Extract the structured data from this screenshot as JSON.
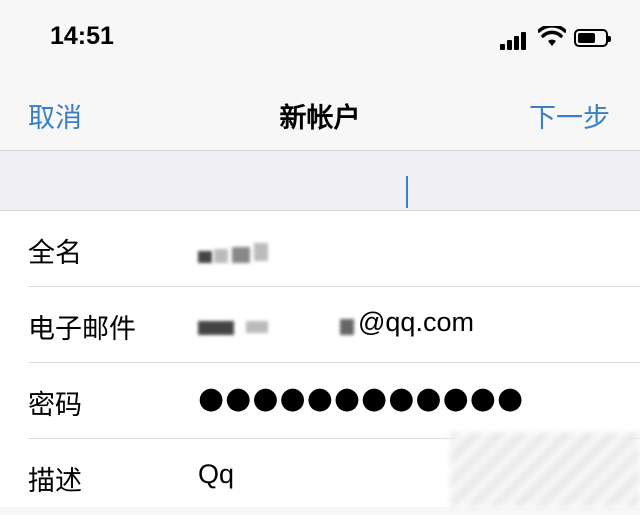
{
  "status_bar": {
    "time": "14:51",
    "icons": [
      "cellular-signal-icon",
      "wifi-icon",
      "battery-icon"
    ]
  },
  "nav": {
    "cancel": "取消",
    "title": "新帐户",
    "next": "下一步",
    "accent_color": "#3a7fc4"
  },
  "form": {
    "full_name": {
      "label": "全名"
    },
    "email": {
      "label": "电子邮件",
      "visible_suffix": "@qq.com"
    },
    "password": {
      "label": "密码",
      "masked_value": "●●●●●●●●●●●●"
    },
    "description": {
      "label": "描述",
      "value": "Qq"
    }
  }
}
